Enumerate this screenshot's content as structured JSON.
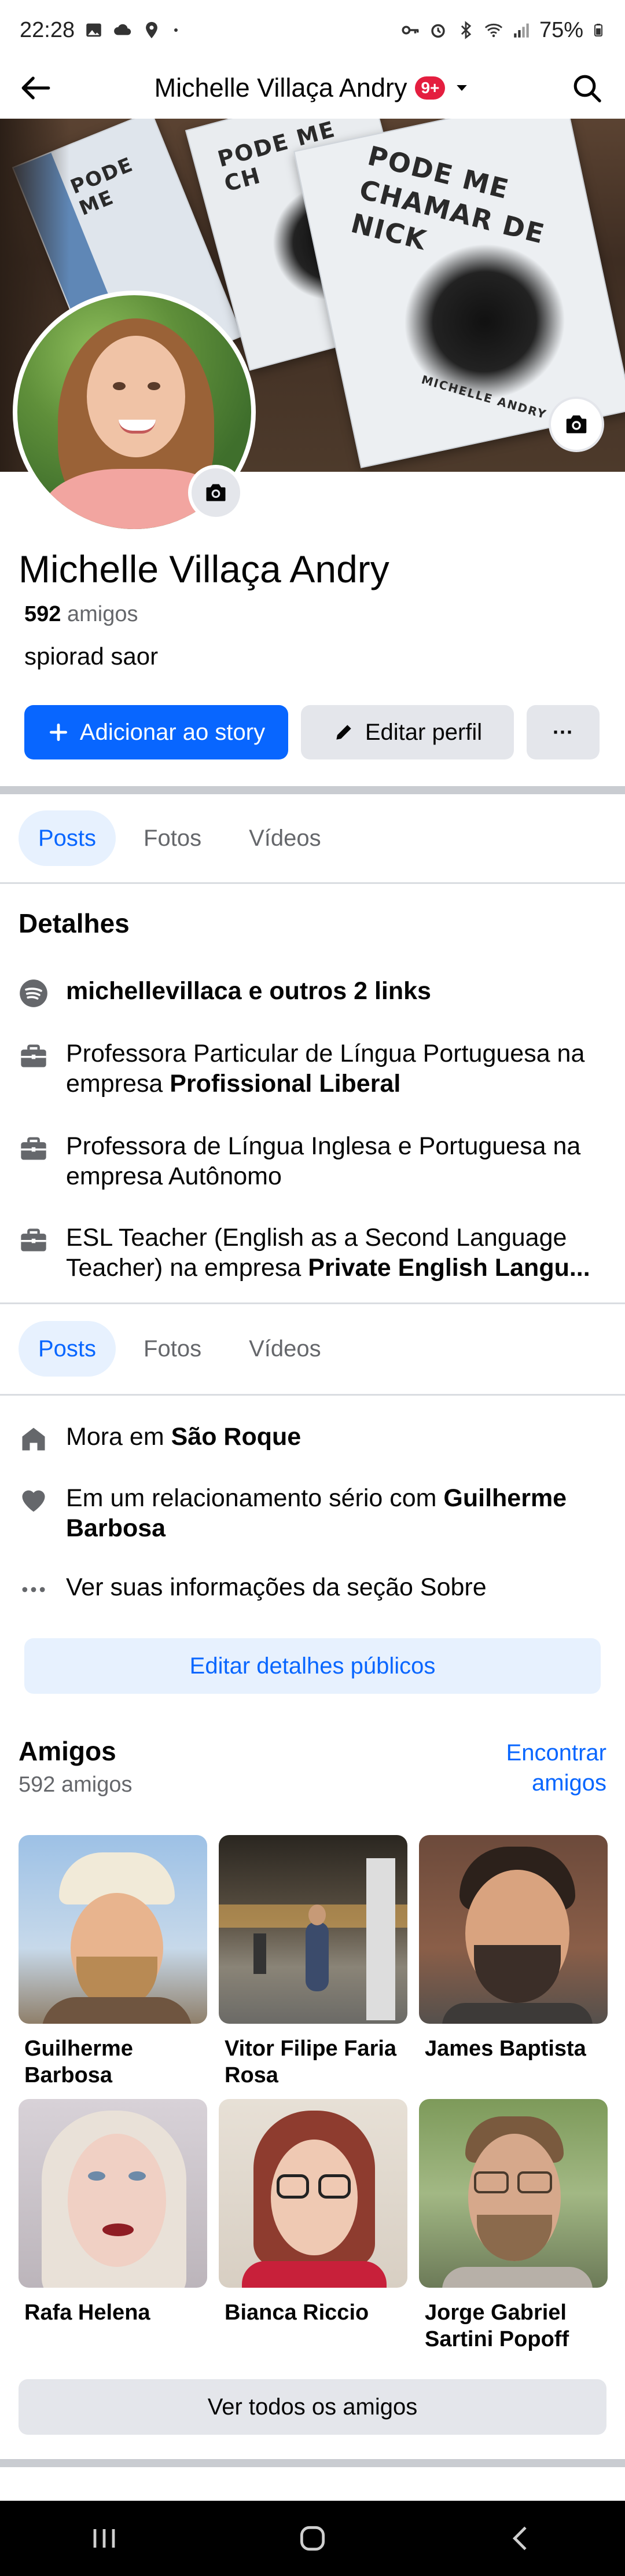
{
  "status_bar": {
    "time": "22:28",
    "battery": "75%",
    "icons": [
      "gallery-icon",
      "cloud-icon",
      "location-icon",
      "dot-icon",
      "key-icon",
      "alarm-icon",
      "bluetooth-icon",
      "wifi-icon",
      "signal-icon",
      "battery-icon"
    ]
  },
  "top_nav": {
    "title": "Michelle Villaça Andry",
    "badge": "9+",
    "back_icon": "arrow-left-icon",
    "search_icon": "search-icon"
  },
  "cover": {
    "book_title_main": "PODE ME CHAMAR DE NICK",
    "book_title_short": "PODE ME CH",
    "book_author": "MICHELLE ANDRY"
  },
  "profile": {
    "name": "Michelle Villaça Andry",
    "friends_count": "592",
    "friends_label": "amigos",
    "bio": "spiorad saor"
  },
  "actions": {
    "add_story": "Adicionar ao story",
    "edit_profile": "Editar perfil",
    "more": "···"
  },
  "tabs_1": [
    {
      "label": "Posts",
      "active": true
    },
    {
      "label": "Fotos",
      "active": false
    },
    {
      "label": "Vídeos",
      "active": false
    }
  ],
  "details": {
    "title": "Detalhes",
    "links": "michellevillaca e outros 2 links",
    "job1_prefix": "Professora Particular de Língua Portuguesa na empresa ",
    "job1_company": "Profissional Liberal",
    "job2_prefix": "Professora de Língua Inglesa e Portuguesa na empresa ",
    "job2_company": "Autônomo",
    "job3_prefix": "ESL Teacher (English as a Second Language Teacher) na empresa ",
    "job3_company": "Private English Langu..."
  },
  "tabs_2": [
    {
      "label": "Posts",
      "active": true
    },
    {
      "label": "Fotos",
      "active": false
    },
    {
      "label": "Vídeos",
      "active": false
    }
  ],
  "about": {
    "lives_prefix": "Mora em ",
    "lives_city": "São Roque",
    "relationship_prefix": "Em um relacionamento sério com ",
    "relationship_name": "Guilherme Barbosa",
    "see_about": "Ver suas informações da seção Sobre",
    "edit_public": "Editar detalhes públicos"
  },
  "friends": {
    "title": "Amigos",
    "count": "592 amigos",
    "find": "Encontrar amigos",
    "see_all": "Ver todos os amigos",
    "list": [
      {
        "name": "Guilherme Barbosa"
      },
      {
        "name": "Vitor Filipe Faria Rosa"
      },
      {
        "name": "James Baptista"
      },
      {
        "name": "Rafa Helena"
      },
      {
        "name": "Bianca Riccio"
      },
      {
        "name": "Jorge Gabriel Sartini Popoff"
      }
    ]
  },
  "system_nav": {
    "icons": [
      "recent-apps-icon",
      "home-icon",
      "back-icon"
    ]
  },
  "colors": {
    "accent": "#0866ff",
    "accent_light": "#e7f1fe",
    "badge": "#e41e3f",
    "secondary_button": "#e4e6eb",
    "text_muted": "#65676b"
  }
}
